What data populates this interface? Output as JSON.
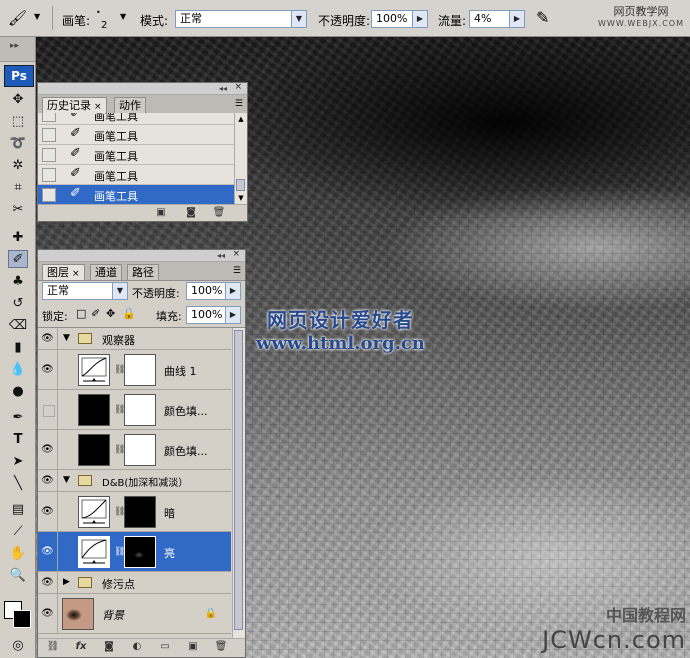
{
  "options_bar": {
    "brush_label": "画笔:",
    "brush_size": "2",
    "mode_label": "模式:",
    "mode_value": "正常",
    "opacity_label": "不透明度:",
    "opacity_value": "100%",
    "flow_label": "流量:",
    "flow_value": "4%",
    "watermark_site": "网页教学网",
    "watermark_url": "WWW.WEBJX.COM"
  },
  "toolbox": {
    "logo": "Ps"
  },
  "history_panel": {
    "tabs": [
      {
        "label": "历史记录",
        "close": "×"
      },
      {
        "label": "动作"
      }
    ],
    "items": [
      {
        "label": "画笔工具",
        "selected": false
      },
      {
        "label": "画笔工具",
        "selected": false
      },
      {
        "label": "画笔工具",
        "selected": false
      },
      {
        "label": "画笔工具",
        "selected": false
      },
      {
        "label": "画笔工具",
        "selected": true
      }
    ]
  },
  "layers_panel": {
    "tabs": [
      {
        "label": "图层",
        "close": "×"
      },
      {
        "label": "通道"
      },
      {
        "label": "路径"
      }
    ],
    "blend_mode": "正常",
    "opacity_label": "不透明度:",
    "opacity_value": "100%",
    "lock_label": "锁定:",
    "fill_label": "填充:",
    "fill_value": "100%",
    "layers": [
      {
        "name": "观察器",
        "kind": "group",
        "visible": true
      },
      {
        "name": "曲线 1",
        "kind": "curves",
        "visible": true
      },
      {
        "name": "颜色填...",
        "kind": "fill",
        "visible": false
      },
      {
        "name": "颜色填...",
        "kind": "fill",
        "visible": true
      },
      {
        "name": "D&B(加深和减淡）",
        "kind": "group",
        "visible": true
      },
      {
        "name": "暗",
        "kind": "curves-mask-black",
        "visible": true
      },
      {
        "name": "亮",
        "kind": "curves-mask-dark",
        "visible": true,
        "selected": true
      },
      {
        "name": "修污点",
        "kind": "group-collapsed",
        "visible": true
      },
      {
        "name": "背景",
        "kind": "background",
        "visible": true
      }
    ]
  },
  "watermarks": {
    "center_line1": "网页设计爱好者",
    "center_line2": "www.html.org.cn",
    "corner_line1": "中国教程网",
    "corner_line2": "JCWcn.com"
  },
  "colors": {
    "selection_blue": "#3169c6",
    "panel_gray": "#d4d0c8"
  }
}
